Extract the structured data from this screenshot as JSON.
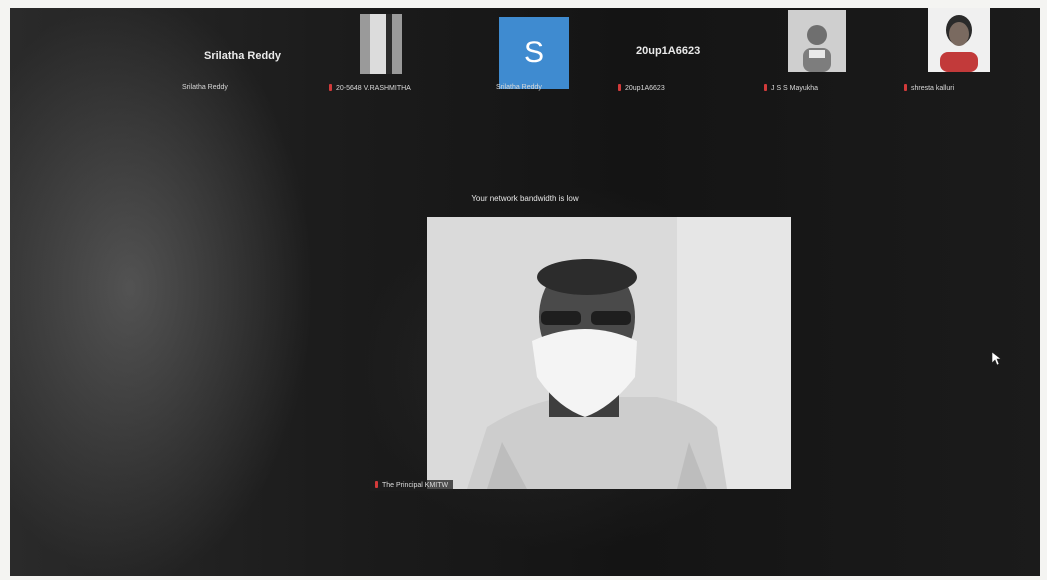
{
  "participants": [
    {
      "display_name": "Srilatha Reddy",
      "label": "Srilatha Reddy"
    },
    {
      "label": "20-5648 V.RASHMITHA"
    },
    {
      "avatar_letter": "S",
      "label": "Srilatha Reddy"
    },
    {
      "display_name": "20up1A6623",
      "label": "20up1A6623"
    },
    {
      "label": "J S S Mayukha"
    },
    {
      "label": "shresta kalluri"
    }
  ],
  "notice": "Your network bandwidth is low",
  "speaker": {
    "label": "The Principal KMITW"
  },
  "colors": {
    "avatar_blue": "#3f8bd0",
    "muted_mic": "#d23a3a"
  }
}
